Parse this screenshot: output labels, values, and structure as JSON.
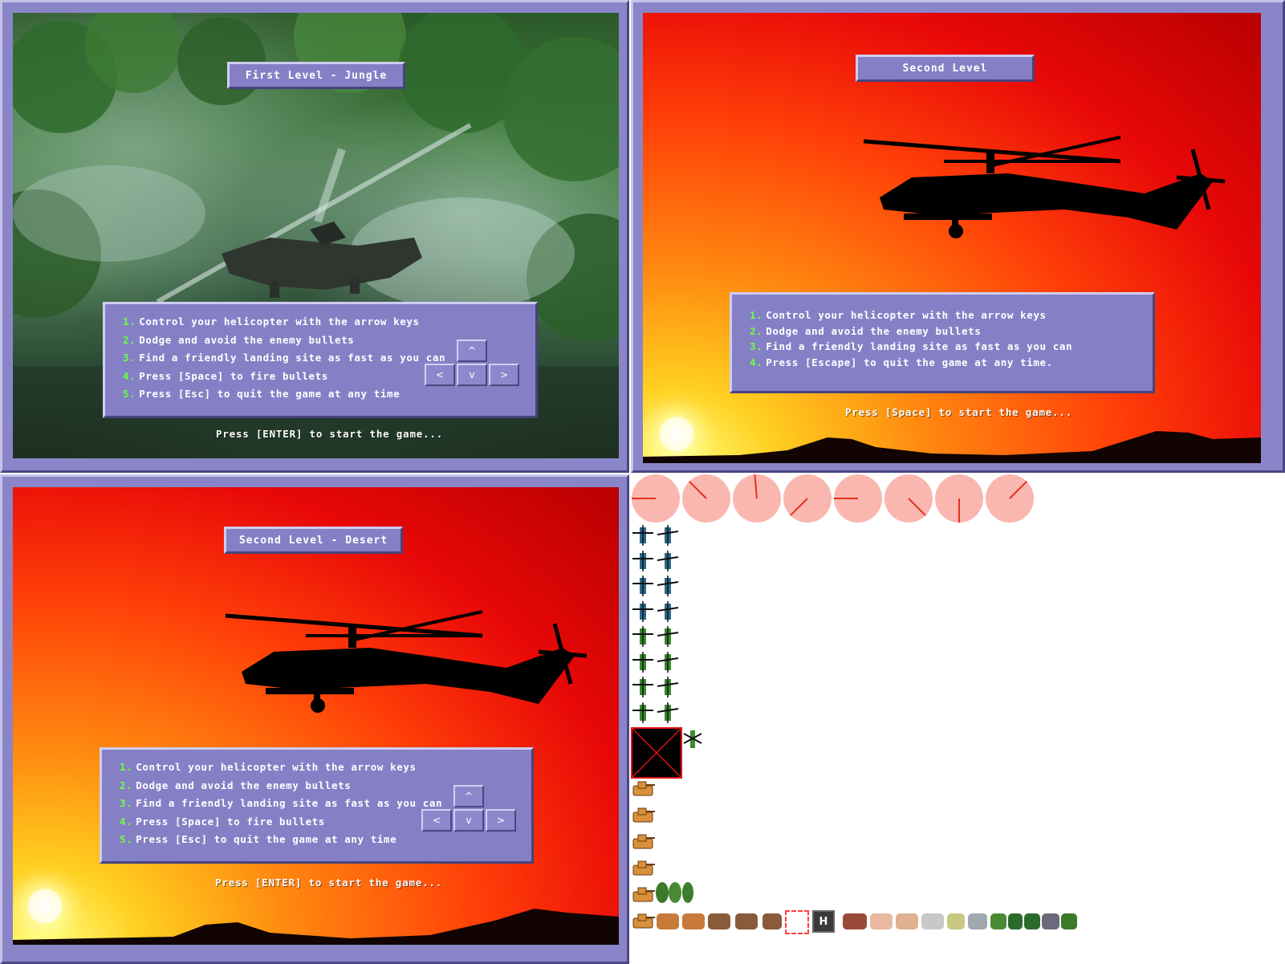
{
  "screens": [
    {
      "title": "First Level - Jungle",
      "instructions": [
        {
          "num": "1.",
          "text": "Control your helicopter with the arrow keys"
        },
        {
          "num": "2.",
          "text": "Dodge and avoid the enemy bullets"
        },
        {
          "num": "3.",
          "text": "Find a friendly landing site as fast as you can"
        },
        {
          "num": "4.",
          "text": "Press [Space] to fire bullets"
        },
        {
          "num": "5.",
          "text": "Press [Esc] to quit the game at any time"
        }
      ],
      "prompt": "Press [ENTER] to start the game..."
    },
    {
      "title": "Second Level",
      "instructions": [
        {
          "num": "1.",
          "text": "Control your helicopter with the arrow keys"
        },
        {
          "num": "2.",
          "text": "Dodge and avoid the enemy bullets"
        },
        {
          "num": "3.",
          "text": "Find a friendly landing site as fast as you can"
        },
        {
          "num": "4.",
          "text": "Press [Escape] to quit the game at any time."
        }
      ],
      "prompt": "Press [Space] to start the game..."
    },
    {
      "title": "Second Level - Desert",
      "instructions": [
        {
          "num": "1.",
          "text": "Control your helicopter with the arrow keys"
        },
        {
          "num": "2.",
          "text": "Dodge and avoid the enemy bullets"
        },
        {
          "num": "3.",
          "text": "Find a friendly landing site as fast as you can"
        },
        {
          "num": "4.",
          "text": "Press [Space] to fire bullets"
        },
        {
          "num": "5.",
          "text": "Press [Esc] to quit the game at any time"
        }
      ],
      "prompt": "Press [ENTER] to start the game..."
    }
  ],
  "keys": {
    "up": "^",
    "down": "v",
    "left": "<",
    "right": ">"
  },
  "sprites": {
    "helipad_letter": "H",
    "colors": {
      "panel": "#8a85c8",
      "text_number": "#6cff3c",
      "radar": "#f9b7b0",
      "radar_sweep": "#e8301c",
      "heli_blue": "#2a6a8a",
      "heli_green": "#3a8a2e",
      "tank": "#d8903a"
    }
  }
}
